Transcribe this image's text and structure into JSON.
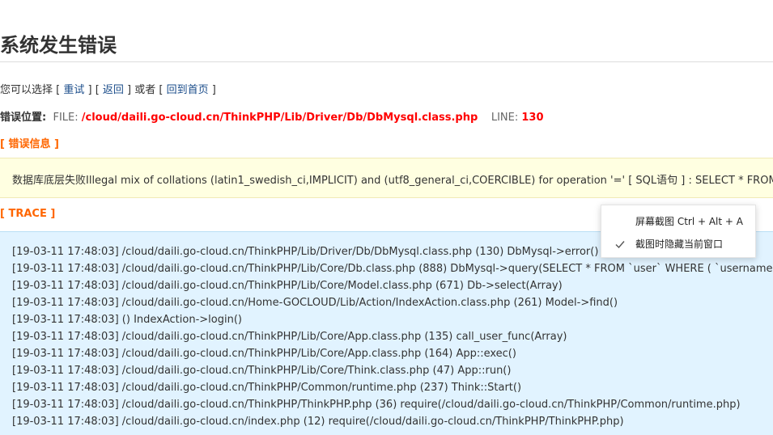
{
  "heading": "系统发生错误",
  "choice": {
    "prefix": "您可以选择 [ ",
    "retry": "重试",
    "sep1": " ] [ ",
    "back": "返回",
    "sep2": " ] 或者 [ ",
    "home": "回到首页",
    "suffix": " ]"
  },
  "location": {
    "label": "错误位置:",
    "file_label": "FILE:",
    "file_path": "/cloud/daili.go-cloud.cn/ThinkPHP/Lib/Driver/Db/DbMysql.class.php",
    "line_label": "LINE:",
    "line_number": "130"
  },
  "error_section": {
    "heading": "[ 错误信息 ]",
    "message": "数据库底层失败Illegal mix of collations (latin1_swedish_ci,IMPLICIT) and (utf8_general_ci,COERCIBLE) for operation '=' [ SQL语句 ] : SELECT * FROM `user` WHERE ( `username` = "
  },
  "trace_section": {
    "heading": "[ TRACE ]",
    "lines": [
      "[19-03-11 17:48:03] /cloud/daili.go-cloud.cn/ThinkPHP/Lib/Driver/Db/DbMysql.class.php (130) DbMysql->error()",
      "[19-03-11 17:48:03] /cloud/daili.go-cloud.cn/ThinkPHP/Lib/Core/Db.class.php (888) DbMysql->query(SELECT * FROM `user` WHERE ( `username` = ",
      "[19-03-11 17:48:03] /cloud/daili.go-cloud.cn/ThinkPHP/Lib/Core/Model.class.php (671) Db->select(Array)",
      "[19-03-11 17:48:03] /cloud/daili.go-cloud.cn/Home-GOCLOUD/Lib/Action/IndexAction.class.php (261) Model->find()",
      "[19-03-11 17:48:03] () IndexAction->login()",
      "[19-03-11 17:48:03] /cloud/daili.go-cloud.cn/ThinkPHP/Lib/Core/App.class.php (135) call_user_func(Array)",
      "[19-03-11 17:48:03] /cloud/daili.go-cloud.cn/ThinkPHP/Lib/Core/App.class.php (164) App::exec()",
      "[19-03-11 17:48:03] /cloud/daili.go-cloud.cn/ThinkPHP/Lib/Core/Think.class.php (47) App::run()",
      "[19-03-11 17:48:03] /cloud/daili.go-cloud.cn/ThinkPHP/Common/runtime.php (237) Think::Start()",
      "[19-03-11 17:48:03] /cloud/daili.go-cloud.cn/ThinkPHP/ThinkPHP.php (36) require(/cloud/daili.go-cloud.cn/ThinkPHP/Common/runtime.php)",
      "[19-03-11 17:48:03] /cloud/daili.go-cloud.cn/index.php (12) require(/cloud/daili.go-cloud.cn/ThinkPHP/ThinkPHP.php)"
    ]
  },
  "context_menu": {
    "items": [
      {
        "label": "屏幕截图 Ctrl + Alt + A",
        "checked": false
      },
      {
        "label": "截图时隐藏当前窗口",
        "checked": true,
        "icon": "checkmark-icon"
      }
    ]
  },
  "colors": {
    "error_red": "#ff0000",
    "section_orange": "#ff6600",
    "link_blue": "#1a4c8a",
    "error_bg": "#ffffe1",
    "trace_bg": "#e1f3ff"
  }
}
